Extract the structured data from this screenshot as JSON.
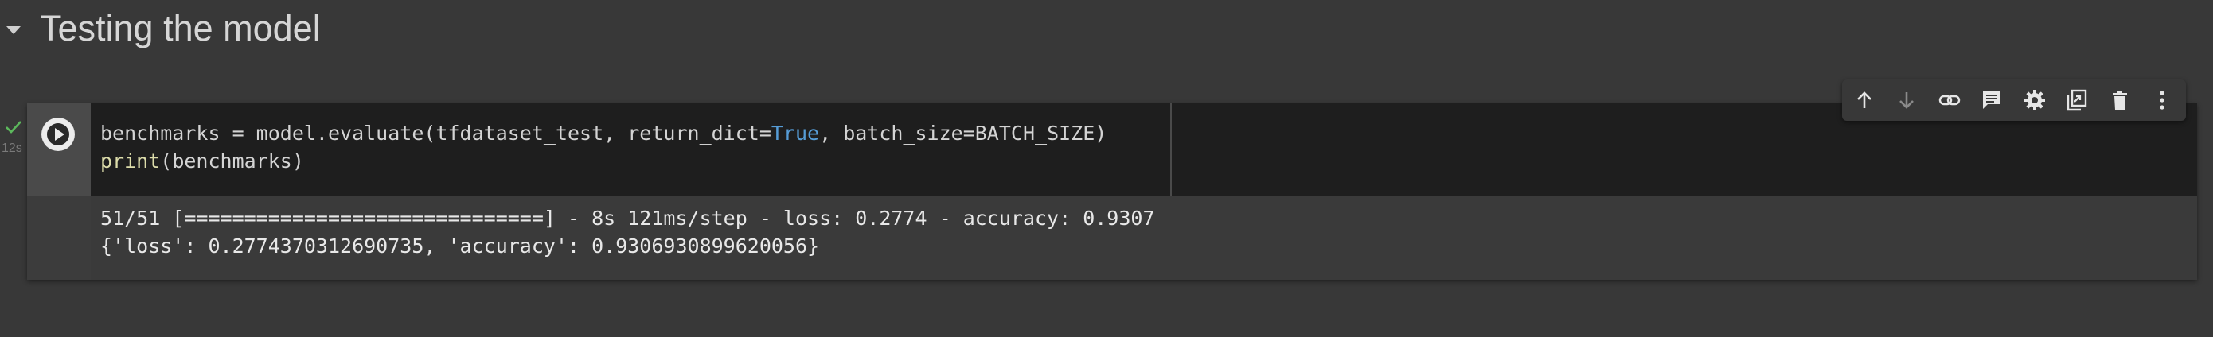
{
  "section": {
    "title": "Testing the model"
  },
  "cell": {
    "exec_time": "12s",
    "code": {
      "line1_pre": "benchmarks = model.evaluate(tfdataset_test, return_dict=",
      "line1_true": "True",
      "line1_post": ", batch_size=BATCH_SIZE)",
      "line2_print": "print",
      "line2_rest": "(benchmarks)"
    },
    "output": {
      "line1": "51/51 [==============================] - 8s 121ms/step - loss: 0.2774 - accuracy: 0.9307",
      "line2": "{'loss': 0.2774370312690735, 'accuracy': 0.9306930899620056}"
    }
  },
  "toolbar": {
    "buttons": [
      {
        "icon": "arrow-up-icon"
      },
      {
        "icon": "arrow-down-icon"
      },
      {
        "icon": "link-icon"
      },
      {
        "icon": "comment-icon"
      },
      {
        "icon": "settings-gear-icon"
      },
      {
        "icon": "mirror-cell-icon"
      },
      {
        "icon": "trash-icon"
      },
      {
        "icon": "more-vert-icon"
      }
    ]
  },
  "colors": {
    "background": "#383838",
    "code_bg": "#1e1e1e",
    "keyword": "#569cd6",
    "builtin": "#dcdcaa",
    "success": "#5cb85c"
  }
}
